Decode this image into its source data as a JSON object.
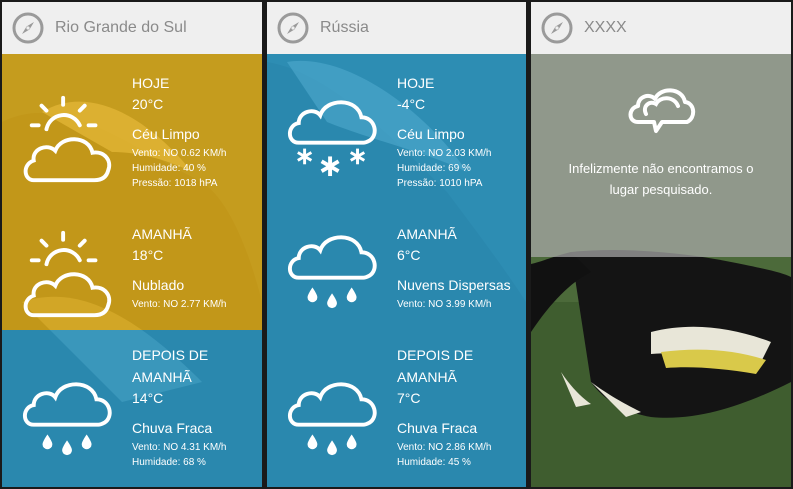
{
  "panels": [
    {
      "title": "Rio Grande do Sul",
      "forecasts": [
        {
          "day": "HOJE",
          "temp": "20°C",
          "desc": "Céu Limpo",
          "icon": "sun-cloud-icon",
          "lines": [
            "Vento: NO 0.62 KM/h",
            "Humidade: 40 %",
            "Pressão: 1018 hPA"
          ]
        },
        {
          "day": "AMANHÃ",
          "temp": "18°C",
          "desc": "Nublado",
          "icon": "sun-cloud-icon",
          "lines": [
            "Vento: NO 2.77 KM/h"
          ]
        },
        {
          "day": "DEPOIS DE",
          "day2": "AMANHÃ",
          "temp": "14°C",
          "desc": "Chuva Fraca",
          "icon": "rain-cloud-icon",
          "lines": [
            "Vento: NO 4.31 KM/h",
            "Humidade: 68 %"
          ]
        }
      ]
    },
    {
      "title": "Rússia",
      "forecasts": [
        {
          "day": "HOJE",
          "temp": "-4°C",
          "desc": "Céu Limpo",
          "icon": "snow-cloud-icon",
          "lines": [
            "Vento: NO 2.03 KM/h",
            "Humidade: 69 %",
            "Pressão: 1010 hPA"
          ]
        },
        {
          "day": "AMANHÃ",
          "temp": "6°C",
          "desc": "Nuvens Dispersas",
          "icon": "rain-cloud-icon",
          "lines": [
            "Vento: NO 3.99 KM/h"
          ]
        },
        {
          "day": "DEPOIS DE",
          "day2": "AMANHÃ",
          "temp": "7°C",
          "desc": "Chuva Fraca",
          "icon": "rain-cloud-icon",
          "lines": [
            "Vento: NO 2.86 KM/h",
            "Humidade: 45 %"
          ]
        }
      ]
    },
    {
      "title": "XXXX",
      "error": {
        "icon": "cloud-speech-icon",
        "message": "Infelizmente não encontramos o lugar pesquisado."
      }
    }
  ],
  "colors": {
    "header": "#efefef",
    "yellow": "#e8b012",
    "blue": "#2a9ecc",
    "error_overlay": "#aaaaaa"
  }
}
